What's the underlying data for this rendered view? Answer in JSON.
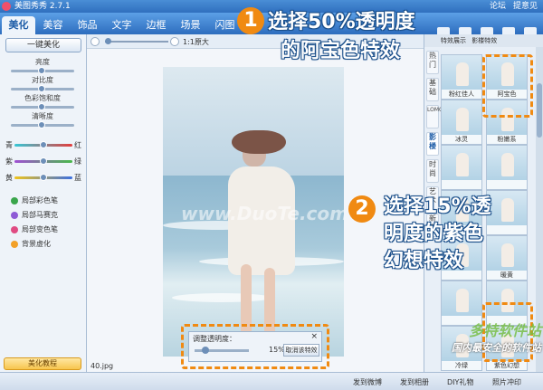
{
  "window": {
    "title": "美图秀秀 2.7.1",
    "top_right": [
      "论坛",
      "提意见"
    ]
  },
  "tabs": [
    "美化",
    "美容",
    "饰品",
    "文字",
    "边框",
    "场景",
    "闪图"
  ],
  "active_tab": 0,
  "toolbar": [
    "打开",
    "尺寸",
    "保存",
    "旋转",
    "截屏"
  ],
  "left": {
    "one_key": "一键美化",
    "sliders": [
      "亮度",
      "对比度",
      "色彩饱和度",
      "清晰度"
    ],
    "color_rows": [
      {
        "left": "青",
        "right": "红",
        "gradient": "linear-gradient(90deg,#36c7d6,#e43d3d)"
      },
      {
        "left": "紫",
        "right": "绿",
        "gradient": "linear-gradient(90deg,#a04fd3,#48b94a)"
      },
      {
        "left": "黄",
        "right": "蓝",
        "gradient": "linear-gradient(90deg,#f0c41b,#3b6fe0)"
      }
    ],
    "tools": [
      {
        "label": "局部彩色笔",
        "color": "#3aa54b"
      },
      {
        "label": "局部马赛克",
        "color": "#8e5bd6"
      },
      {
        "label": "局部变色笔",
        "color": "#e04b83"
      },
      {
        "label": "背景虚化",
        "color": "#f2a028"
      }
    ],
    "tutorial": "美化教程"
  },
  "center": {
    "zoom_text": "1:1原大",
    "filename": "40.jpg",
    "watermark": "www.DuoTe.com",
    "transparency": {
      "title": "调整透明度：",
      "value": "15%",
      "value_fraction": 0.15,
      "cancel": "取消该特效",
      "close": "×"
    }
  },
  "right": {
    "tabs": [
      "特效展示",
      "影楼特效"
    ],
    "categories": [
      "热门",
      "基础",
      "LOMO",
      "影楼",
      "时尚",
      "艺术",
      "新潮"
    ],
    "active_category": 3,
    "thumbs": [
      {
        "label": "粉红佳人"
      },
      {
        "label": "阿宝色"
      },
      {
        "label": "冰灵"
      },
      {
        "label": "粉嫩系"
      },
      {
        "label": ""
      },
      {
        "label": ""
      },
      {
        "label": ""
      },
      {
        "label": ""
      },
      {
        "label": ""
      },
      {
        "label": "暖黄"
      },
      {
        "label": ""
      },
      {
        "label": ""
      },
      {
        "label": "冷绿"
      },
      {
        "label": "紫色幻想"
      }
    ]
  },
  "status": [
    "发到微博",
    "发到相册",
    "DIY礼物",
    "照片冲印"
  ],
  "annotations": {
    "step1_number": "1",
    "step1_text_line1": "选择50%透明度",
    "step1_text_line2": "的阿宝色特效",
    "step2_number": "2",
    "step2_text_line1": "选择15%透",
    "step2_text_line2": "明度的紫色",
    "step2_text_line3": "幻想特效",
    "brand": "多特软件站",
    "brand_sub": "国内最安全的软件站"
  },
  "colors": {
    "accent": "#f08a12",
    "title_bar": "#2f6fbe"
  }
}
